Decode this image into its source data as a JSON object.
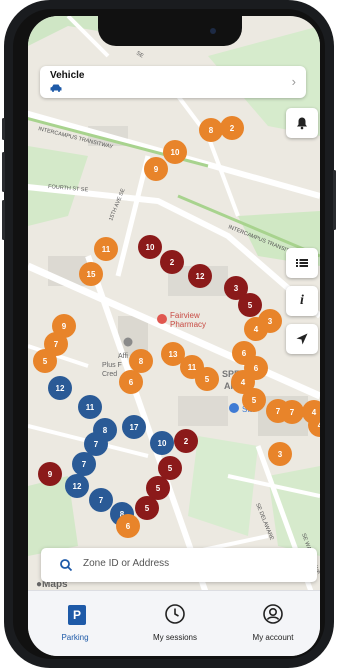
{
  "vehicle": {
    "label": "Vehicle"
  },
  "map": {
    "street_labels": [
      {
        "text": "INTERCAMPUS TRANSITWAY"
      },
      {
        "text": "FOURTH ST SE"
      },
      {
        "text": "15TH AVE SE"
      },
      {
        "text": "INTERCAMPUS TRANSITWAY"
      },
      {
        "text": "SE"
      },
      {
        "text": "SE DELAWARE"
      },
      {
        "text": "SE WALNUT AVE"
      }
    ],
    "places": [
      {
        "text": "Fairview"
      },
      {
        "text": "Pharmacy"
      },
      {
        "text": "Affi"
      },
      {
        "text": "Plus F"
      },
      {
        "text": "Cred"
      },
      {
        "text": "SPECT"
      },
      {
        "text": "ARK"
      },
      {
        "text": "Sta"
      }
    ],
    "attribution": "Maps",
    "markers": [
      {
        "label": "8",
        "color": "#e8842a"
      },
      {
        "label": "2",
        "color": "#e8842a"
      },
      {
        "label": "10",
        "color": "#e8842a"
      },
      {
        "label": "9",
        "color": "#e8842a"
      },
      {
        "label": "10",
        "color": "#8b1a1a"
      },
      {
        "label": "2",
        "color": "#8b1a1a"
      },
      {
        "label": "11",
        "color": "#e8842a"
      },
      {
        "label": "15",
        "color": "#e8842a"
      },
      {
        "label": "12",
        "color": "#8b1a1a"
      },
      {
        "label": "3",
        "color": "#8b1a1a"
      },
      {
        "label": "5",
        "color": "#8b1a1a"
      },
      {
        "label": "4",
        "color": "#e8842a"
      },
      {
        "label": "3",
        "color": "#e8842a"
      },
      {
        "label": "6",
        "color": "#e8842a"
      },
      {
        "label": "9",
        "color": "#e8842a"
      },
      {
        "label": "7",
        "color": "#e8842a"
      },
      {
        "label": "5",
        "color": "#e8842a"
      },
      {
        "label": "8",
        "color": "#e8842a"
      },
      {
        "label": "13",
        "color": "#e8842a"
      },
      {
        "label": "11",
        "color": "#e8842a"
      },
      {
        "label": "5",
        "color": "#e8842a"
      },
      {
        "label": "6",
        "color": "#e8842a"
      },
      {
        "label": "6",
        "color": "#e8842a"
      },
      {
        "label": "4",
        "color": "#e8842a"
      },
      {
        "label": "5",
        "color": "#e8842a"
      },
      {
        "label": "7",
        "color": "#e8842a"
      },
      {
        "label": "12",
        "color": "#2a5a96"
      },
      {
        "label": "11",
        "color": "#2a5a96"
      },
      {
        "label": "8",
        "color": "#2a5a96"
      },
      {
        "label": "7",
        "color": "#2a5a96"
      },
      {
        "label": "17",
        "color": "#2a5a96"
      },
      {
        "label": "10",
        "color": "#2a5a96"
      },
      {
        "label": "2",
        "color": "#8b1a1a"
      },
      {
        "label": "7",
        "color": "#2a5a96"
      },
      {
        "label": "9",
        "color": "#8b1a1a"
      },
      {
        "label": "12",
        "color": "#2a5a96"
      },
      {
        "label": "5",
        "color": "#8b1a1a"
      },
      {
        "label": "7",
        "color": "#2a5a96"
      },
      {
        "label": "8",
        "color": "#2a5a96"
      },
      {
        "label": "5",
        "color": "#8b1a1a"
      },
      {
        "label": "5",
        "color": "#8b1a1a"
      },
      {
        "label": "4",
        "color": "#e8842a"
      },
      {
        "label": "3",
        "color": "#e8842a"
      },
      {
        "label": "7",
        "color": "#e8842a"
      },
      {
        "label": "4",
        "color": "#e8842a"
      },
      {
        "label": "6",
        "color": "#e8842a"
      }
    ]
  },
  "search": {
    "placeholder": "Zone ID or Address"
  },
  "nav": {
    "parking": "Parking",
    "parking_badge": "P",
    "sessions": "My sessions",
    "account": "My account"
  },
  "colors": {
    "accent": "#1e5aa8",
    "orange": "#e8842a",
    "maroon": "#8b1a1a",
    "blue": "#2a5a96"
  }
}
